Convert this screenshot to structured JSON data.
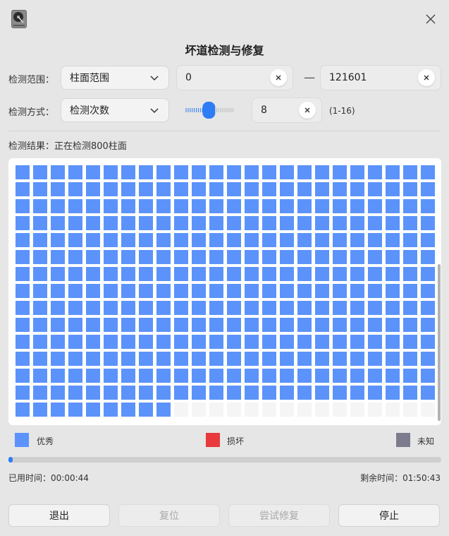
{
  "window": {
    "title": "坏道检测与修复"
  },
  "range": {
    "label": "检测范围：",
    "mode": "柱面范围",
    "start": "0",
    "separator": "—",
    "end": "121601"
  },
  "method": {
    "label": "检测方式：",
    "mode": "检测次数",
    "count": "8",
    "count_hint": "(1-16)",
    "slider_level": 0.47
  },
  "result": {
    "label": "检测结果：",
    "status": "正在检测800柱面"
  },
  "grid": {
    "columns": 24,
    "rows": 15,
    "good_count": 345,
    "status_colors": {
      "good": "#5b93fb",
      "bad": "#e8393d",
      "unknown": "#7c7c8e",
      "pending": "#f5f5f5"
    }
  },
  "legend": {
    "good": "优秀",
    "bad": "损坏",
    "unknown": "未知"
  },
  "progress": {
    "value": 0.01
  },
  "time": {
    "elapsed_label": "已用时间：",
    "elapsed": "00:00:44",
    "remaining_label": "剩余时间：",
    "remaining": "01:50:43"
  },
  "buttons": {
    "exit": "退出",
    "reset": "复位",
    "try_repair": "尝试修复",
    "stop": "停止"
  }
}
